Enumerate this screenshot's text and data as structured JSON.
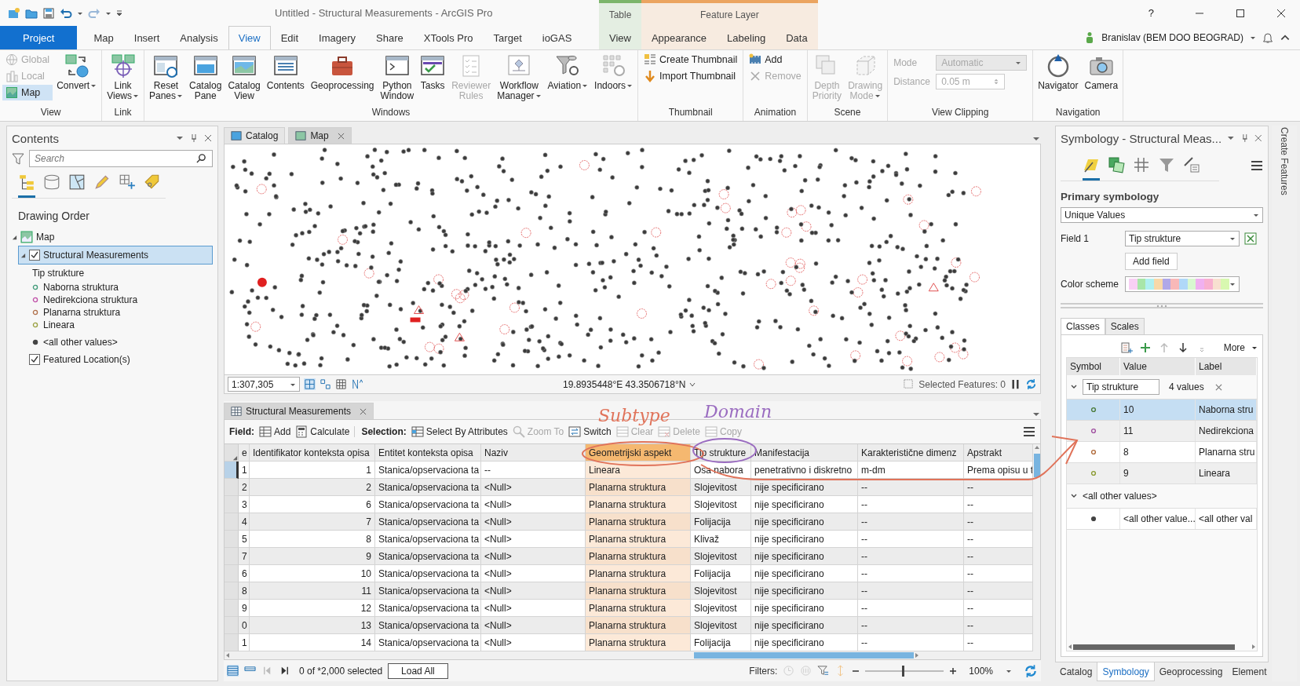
{
  "title_bar": {
    "title": "Untitled - Structural Measurements - ArcGIS Pro",
    "help": "?"
  },
  "tabs": [
    {
      "label": "Project",
      "kind": "backstage",
      "selected": false
    },
    {
      "label": "Map",
      "kind": "tab",
      "selected": false
    },
    {
      "label": "Insert",
      "kind": "tab",
      "selected": false
    },
    {
      "label": "Analysis",
      "kind": "tab",
      "selected": false
    },
    {
      "label": "View",
      "kind": "tab",
      "selected": true
    },
    {
      "label": "Edit",
      "kind": "tab",
      "selected": false
    },
    {
      "label": "Imagery",
      "kind": "tab",
      "selected": false
    },
    {
      "label": "Share",
      "kind": "tab",
      "selected": false
    },
    {
      "label": "XTools Pro",
      "kind": "tab",
      "selected": false
    },
    {
      "label": "Target",
      "kind": "tab",
      "selected": false
    },
    {
      "label": "ioGAS",
      "kind": "tab",
      "selected": false
    }
  ],
  "contextual_tabs": [
    {
      "title": "Table",
      "color": "#7cb56b",
      "tabs": [
        {
          "label": "View",
          "selected": false
        }
      ]
    },
    {
      "title": "Feature Layer",
      "color": "#eba460",
      "tabs": [
        {
          "label": "Appearance",
          "selected": false
        },
        {
          "label": "Labeling",
          "selected": false
        },
        {
          "label": "Data",
          "selected": false
        }
      ]
    }
  ],
  "user": {
    "name": "Branislav (BEM DOO BEOGRAD)"
  },
  "ribbon": [
    {
      "name": "View",
      "items": [
        {
          "kind": "stack",
          "buttons": [
            {
              "label": "Global",
              "disabled": true,
              "selected": false
            },
            {
              "label": "Local",
              "disabled": true,
              "selected": false
            },
            {
              "label": "Map",
              "disabled": false,
              "selected": true
            }
          ]
        },
        {
          "kind": "large",
          "label": "Convert",
          "dropdown": true,
          "disabled": false
        }
      ]
    },
    {
      "name": "Link",
      "items": [
        {
          "kind": "large",
          "label": "Link\nViews",
          "dropdown": true,
          "disabled": false
        }
      ]
    },
    {
      "name": "Windows",
      "items": [
        {
          "kind": "large",
          "label": "Reset\nPanes",
          "dropdown": true,
          "disabled": false
        },
        {
          "kind": "large",
          "label": "Catalog\nPane",
          "dropdown": false,
          "disabled": false
        },
        {
          "kind": "large",
          "label": "Catalog\nView",
          "dropdown": false,
          "disabled": false
        },
        {
          "kind": "large",
          "label": "Contents",
          "dropdown": false,
          "disabled": false
        },
        {
          "kind": "large",
          "label": "Geoprocessing",
          "dropdown": false,
          "disabled": false
        },
        {
          "kind": "large",
          "label": "Python\nWindow",
          "dropdown": false,
          "disabled": false
        },
        {
          "kind": "large",
          "label": "Tasks",
          "dropdown": false,
          "disabled": false
        },
        {
          "kind": "large",
          "label": "Reviewer\nRules",
          "dropdown": false,
          "disabled": true
        },
        {
          "kind": "large",
          "label": "Workflow\nManager",
          "dropdown": true,
          "disabled": false
        },
        {
          "kind": "large",
          "label": "Aviation",
          "dropdown": true,
          "disabled": false
        },
        {
          "kind": "large",
          "label": "Indoors",
          "dropdown": true,
          "disabled": false
        }
      ]
    },
    {
      "name": "Thumbnail",
      "items": [
        {
          "kind": "stack",
          "buttons": [
            {
              "label": "Create Thumbnail",
              "disabled": false
            },
            {
              "label": "Import Thumbnail",
              "disabled": false
            }
          ]
        }
      ]
    },
    {
      "name": "Animation",
      "items": [
        {
          "kind": "stack",
          "buttons": [
            {
              "label": "Add",
              "disabled": false
            },
            {
              "label": "Remove",
              "disabled": true
            }
          ]
        }
      ]
    },
    {
      "name": "Scene",
      "items": [
        {
          "kind": "large",
          "label": "Depth\nPriority",
          "dropdown": false,
          "disabled": true
        },
        {
          "kind": "large",
          "label": "Drawing\nMode",
          "dropdown": true,
          "disabled": true
        }
      ]
    },
    {
      "name": "View Clipping",
      "items": [
        {
          "kind": "fields",
          "fields": [
            {
              "label": "Mode",
              "value": "Automatic",
              "kind": "dropdown",
              "disabled": true
            },
            {
              "label": "Distance",
              "value": "0.05  m",
              "kind": "spinner",
              "disabled": true
            }
          ]
        }
      ]
    },
    {
      "name": "Navigation",
      "items": [
        {
          "kind": "large",
          "label": "Navigator",
          "dropdown": false,
          "disabled": false
        },
        {
          "kind": "large",
          "label": "Camera",
          "dropdown": false,
          "disabled": false
        }
      ]
    }
  ],
  "contents": {
    "title": "Contents",
    "search": {
      "placeholder": "Search"
    },
    "view_tabs": [
      {
        "selected": true
      },
      {
        "selected": false
      },
      {
        "selected": false
      },
      {
        "selected": false
      },
      {
        "selected": false
      },
      {
        "selected": false
      }
    ],
    "section": "Drawing Order",
    "tree": [
      {
        "label": "Map",
        "kind": "map",
        "expanded": true,
        "children": [
          {
            "label": "Structural Measurements",
            "kind": "layer",
            "checked": true,
            "selected": true,
            "expanded": true,
            "legend": {
              "heading": "Tip strukture",
              "classes": [
                {
                  "label": "Naborna struktura",
                  "color": "#3f9a78"
                },
                {
                  "label": "Nedirekciona struktura",
                  "color": "#c050a8"
                },
                {
                  "label": "Planarna struktura",
                  "color": "#b0704a"
                },
                {
                  "label": "Lineara",
                  "color": "#9aa040"
                },
                {
                  "label": "<all other values>",
                  "color": "#444444"
                }
              ]
            }
          },
          {
            "label": "Featured Location(s)",
            "kind": "layer",
            "checked": true,
            "selected": false,
            "expanded": false
          }
        ]
      }
    ]
  },
  "map_view": {
    "tabs": [
      {
        "label": "Catalog",
        "selected": false,
        "closable": false
      },
      {
        "label": "Map",
        "selected": true,
        "closable": true
      }
    ],
    "scale": "1:307,305",
    "coordinates": "19.8935448°E 43.3506718°N",
    "selected_features": "Selected Features: 0"
  },
  "attribute_table": {
    "tab": "Structural Measurements",
    "toolbar": [
      {
        "kind": "label",
        "text": "Field:"
      },
      {
        "kind": "button",
        "label": "Add",
        "disabled": false
      },
      {
        "kind": "button",
        "label": "Calculate",
        "disabled": false
      },
      {
        "kind": "label",
        "text": "Selection:"
      },
      {
        "kind": "button",
        "label": "Select By Attributes",
        "disabled": false
      },
      {
        "kind": "button",
        "label": "Zoom To",
        "disabled": true
      },
      {
        "kind": "button",
        "label": "Switch",
        "disabled": false
      },
      {
        "kind": "button",
        "label": "Clear",
        "disabled": true
      },
      {
        "kind": "button",
        "label": "Delete",
        "disabled": true
      },
      {
        "kind": "button",
        "label": "Copy",
        "disabled": true
      }
    ],
    "columns": [
      {
        "label": "e",
        "kind": "text"
      },
      {
        "label": "Identifikator konteksta opisa",
        "kind": "number"
      },
      {
        "label": "Entitet konteksta opisa",
        "kind": "text"
      },
      {
        "label": "Naziv",
        "kind": "text"
      },
      {
        "label": "Geometrijski aspekt",
        "kind": "subtype"
      },
      {
        "label": "Tip strukture",
        "kind": "text"
      },
      {
        "label": "Manifestacija",
        "kind": "text"
      },
      {
        "label": "Karakteristične dimenz",
        "kind": "text"
      },
      {
        "label": "Apstrakt",
        "kind": "text"
      }
    ],
    "rows": [
      {
        "selected": true,
        "cells": [
          "1",
          "1",
          "Stanica/opservaciona ta",
          "--",
          "Lineara",
          "Osa nabora",
          "penetrativno i diskretno",
          "m-dm",
          "Prema opisu u t"
        ]
      },
      {
        "selected": false,
        "cells": [
          "2",
          "2",
          "Stanica/opservaciona ta",
          "<Null>",
          "Planarna struktura",
          "Slojevitost",
          "nije specificirano",
          "--",
          "--"
        ]
      },
      {
        "selected": false,
        "cells": [
          "3",
          "6",
          "Stanica/opservaciona ta",
          "<Null>",
          "Planarna struktura",
          "Slojevitost",
          "nije specificirano",
          "--",
          "--"
        ]
      },
      {
        "selected": false,
        "cells": [
          "4",
          "7",
          "Stanica/opservaciona ta",
          "<Null>",
          "Planarna struktura",
          "Folijacija",
          "nije specificirano",
          "--",
          "--"
        ]
      },
      {
        "selected": false,
        "cells": [
          "5",
          "8",
          "Stanica/opservaciona ta",
          "<Null>",
          "Planarna struktura",
          "Klivaž",
          "nije specificirano",
          "--",
          "--"
        ]
      },
      {
        "selected": false,
        "cells": [
          "7",
          "9",
          "Stanica/opservaciona ta",
          "<Null>",
          "Planarna struktura",
          "Slojevitost",
          "nije specificirano",
          "--",
          "--"
        ]
      },
      {
        "selected": false,
        "cells": [
          "6",
          "10",
          "Stanica/opservaciona ta",
          "<Null>",
          "Planarna struktura",
          "Folijacija",
          "nije specificirano",
          "--",
          "--"
        ]
      },
      {
        "selected": false,
        "cells": [
          "8",
          "11",
          "Stanica/opservaciona ta",
          "<Null>",
          "Planarna struktura",
          "Slojevitost",
          "nije specificirano",
          "--",
          "--"
        ]
      },
      {
        "selected": false,
        "cells": [
          "9",
          "12",
          "Stanica/opservaciona ta",
          "<Null>",
          "Planarna struktura",
          "Slojevitost",
          "nije specificirano",
          "--",
          "--"
        ]
      },
      {
        "selected": false,
        "cells": [
          "0",
          "13",
          "Stanica/opservaciona ta",
          "<Null>",
          "Planarna struktura",
          "Slojevitost",
          "nije specificirano",
          "--",
          "--"
        ]
      },
      {
        "selected": false,
        "cells": [
          "1",
          "14",
          "Stanica/opservaciona ta",
          "<Null>",
          "Planarna struktura",
          "Folijacija",
          "nije specificirano",
          "--",
          "--"
        ]
      }
    ],
    "selection_count": "0 of *2,000 selected",
    "load_all": "Load All",
    "filters_label": "Filters:",
    "zoom": {
      "level": 0.48,
      "value": "100%"
    }
  },
  "symbology": {
    "title": "Symbology - Structural Meas...",
    "view_tabs": [
      {
        "selected": true
      },
      {
        "selected": false
      },
      {
        "selected": false
      },
      {
        "selected": false
      },
      {
        "selected": false
      }
    ],
    "heading": "Primary symbology",
    "renderer": "Unique Values",
    "field_label": "Field 1",
    "field": "Tip strukture",
    "add_field": "Add field",
    "color_scheme_label": "Color scheme",
    "swatches": [
      {
        "color": "#f8d0f4"
      },
      {
        "color": "#a8e6a8"
      },
      {
        "color": "#b0f0f0"
      },
      {
        "color": "#f8d8a8"
      },
      {
        "color": "#b0a8e8"
      },
      {
        "color": "#f8b8b8"
      },
      {
        "color": "#b0d8f8"
      },
      {
        "color": "#d8f8d0"
      },
      {
        "color": "#f0b0f0"
      },
      {
        "color": "#f8b0d0"
      },
      {
        "color": "#f8e0d0"
      },
      {
        "color": "#d8f8b0"
      }
    ],
    "tabs": [
      {
        "label": "Classes",
        "selected": true
      },
      {
        "label": "Scales",
        "selected": false
      }
    ],
    "more": "More",
    "columns": [
      "Symbol",
      "Value",
      "Label"
    ],
    "groups": [
      {
        "field": "Tip strukture",
        "count": "4 values",
        "expanded": true,
        "rows": [
          {
            "value": "10",
            "label": "Naborna stru",
            "color": "#4a7a3a",
            "selected": true
          },
          {
            "value": "11",
            "label": "Nedirekciona",
            "color": "#a050a0",
            "selected": false
          },
          {
            "value": "8",
            "label": "Planarna stru",
            "color": "#b06a3a",
            "selected": false
          },
          {
            "value": "9",
            "label": "Lineara",
            "color": "#8a9a30",
            "selected": false
          }
        ]
      },
      {
        "title": "<all other values>",
        "expanded": true,
        "rows": [
          {
            "value": "<all other value...",
            "label": "<all other val",
            "color": "#444444",
            "selected": false
          }
        ]
      }
    ],
    "bottom_tabs": [
      {
        "label": "Catalog",
        "selected": false
      },
      {
        "label": "Symbology",
        "selected": true
      },
      {
        "label": "Geoprocessing",
        "selected": false
      },
      {
        "label": "Element",
        "selected": false
      }
    ]
  },
  "side_strip": {
    "label": "Create Features"
  },
  "annotations": [
    {
      "text": "Subtype",
      "color": "#e0735a"
    },
    {
      "text": "Domain",
      "color": "#9a6cc0"
    }
  ]
}
